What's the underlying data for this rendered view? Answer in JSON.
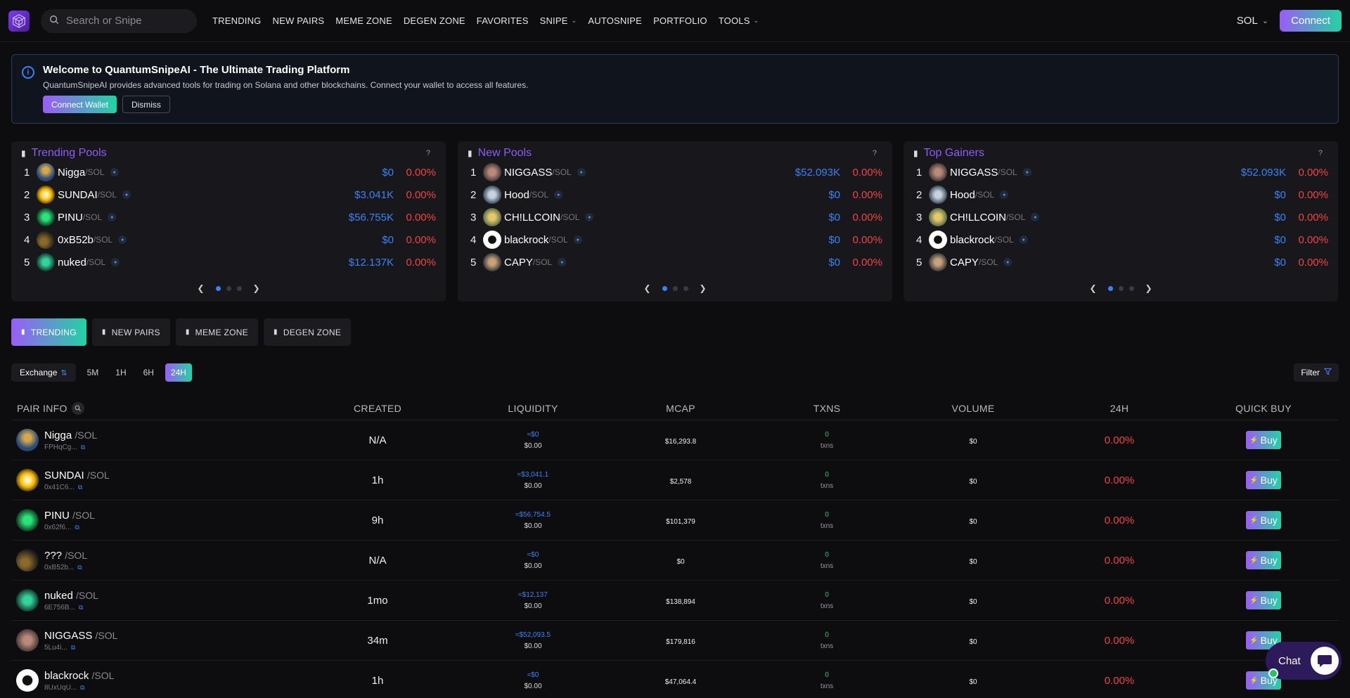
{
  "nav": {
    "search_placeholder": "Search or Snipe",
    "menu": [
      {
        "label": "TRENDING",
        "dropdown": false
      },
      {
        "label": "NEW PAIRS",
        "dropdown": false
      },
      {
        "label": "MEME ZONE",
        "dropdown": false
      },
      {
        "label": "DEGEN ZONE",
        "dropdown": false
      },
      {
        "label": "FAVORITES",
        "dropdown": false
      },
      {
        "label": "SNIPE",
        "dropdown": true
      },
      {
        "label": "AUTOSNIPE",
        "dropdown": false
      },
      {
        "label": "PORTFOLIO",
        "dropdown": false
      },
      {
        "label": "TOOLS",
        "dropdown": true
      }
    ],
    "chain": "SOL",
    "connect_label": "Connect"
  },
  "banner": {
    "title": "Welcome to QuantumSnipeAI - The Ultimate Trading Platform",
    "text": "QuantumSnipeAI provides advanced tools for trading on Solana and other blockchains. Connect your wallet to access all features.",
    "connect_wallet_label": "Connect Wallet",
    "dismiss_label": "Dismiss"
  },
  "cards": [
    {
      "title": "Trending Pools",
      "help": "?",
      "rows": [
        {
          "rank": "1",
          "name": "Nigga",
          "quote": "/SOL",
          "value": "$0",
          "pct": "0.00%"
        },
        {
          "rank": "2",
          "name": "SUNDAI",
          "quote": "/SOL",
          "value": "$3.041K",
          "pct": "0.00%"
        },
        {
          "rank": "3",
          "name": "PINU",
          "quote": "/SOL",
          "value": "$56.755K",
          "pct": "0.00%"
        },
        {
          "rank": "4",
          "name": "0xB52b",
          "quote": "/SOL",
          "value": "$0",
          "pct": "0.00%"
        },
        {
          "rank": "5",
          "name": "nuked",
          "quote": "/SOL",
          "value": "$12.137K",
          "pct": "0.00%"
        }
      ]
    },
    {
      "title": "New Pools",
      "help": "?",
      "rows": [
        {
          "rank": "1",
          "name": "NIGGASS",
          "quote": "/SOL",
          "value": "$52.093K",
          "pct": "0.00%"
        },
        {
          "rank": "2",
          "name": "Hood",
          "quote": "/SOL",
          "value": "$0",
          "pct": "0.00%"
        },
        {
          "rank": "3",
          "name": "CH!LLCOIN",
          "quote": "/SOL",
          "value": "$0",
          "pct": "0.00%"
        },
        {
          "rank": "4",
          "name": "blackrock",
          "quote": "/SOL",
          "value": "$0",
          "pct": "0.00%"
        },
        {
          "rank": "5",
          "name": "CAPY",
          "quote": "/SOL",
          "value": "$0",
          "pct": "0.00%"
        }
      ]
    },
    {
      "title": "Top Gainers",
      "help": "?",
      "rows": [
        {
          "rank": "1",
          "name": "NIGGASS",
          "quote": "/SOL",
          "value": "$52.093K",
          "pct": "0.00%"
        },
        {
          "rank": "2",
          "name": "Hood",
          "quote": "/SOL",
          "value": "$0",
          "pct": "0.00%"
        },
        {
          "rank": "3",
          "name": "CH!LLCOIN",
          "quote": "/SOL",
          "value": "$0",
          "pct": "0.00%"
        },
        {
          "rank": "4",
          "name": "blackrock",
          "quote": "/SOL",
          "value": "$0",
          "pct": "0.00%"
        },
        {
          "rank": "5",
          "name": "CAPY",
          "quote": "/SOL",
          "value": "$0",
          "pct": "0.00%"
        }
      ]
    }
  ],
  "tabs": [
    "TRENDING",
    "NEW PAIRS",
    "MEME ZONE",
    "DEGEN ZONE"
  ],
  "filters": {
    "exchange_label": "Exchange",
    "timeframes": [
      "5M",
      "1H",
      "6H",
      "24H"
    ],
    "active_timeframe": "24H",
    "filter_label": "Filter"
  },
  "table": {
    "headers": {
      "pair": "PAIR INFO",
      "created": "CREATED",
      "liquidity": "LIQUIDITY",
      "mcap": "MCAP",
      "txns": "TXNS",
      "volume": "VOLUME",
      "change": "24H",
      "quick_buy": "QUICK BUY"
    },
    "buy_label": "Buy",
    "rows": [
      {
        "name": "Nigga",
        "quote": "/SOL",
        "addr": "FPHqCg...",
        "created": "N/A",
        "liq_a": "≈$0",
        "liq_b": "$0.00",
        "mcap": "$16,293.8",
        "txns": "0",
        "txns_label": "txns",
        "volume": "$0",
        "change": "0.00%"
      },
      {
        "name": "SUNDAI",
        "quote": "/SOL",
        "addr": "0x41C6...",
        "created": "1h",
        "liq_a": "≈$3,041.1",
        "liq_b": "$0.00",
        "mcap": "$2,578",
        "txns": "0",
        "txns_label": "txns",
        "volume": "$0",
        "change": "0.00%"
      },
      {
        "name": "PINU",
        "quote": "/SOL",
        "addr": "0x62f6...",
        "created": "9h",
        "liq_a": "≈$56,754.5",
        "liq_b": "$0.00",
        "mcap": "$101,379",
        "txns": "0",
        "txns_label": "txns",
        "volume": "$0",
        "change": "0.00%"
      },
      {
        "name": "???",
        "quote": "/SOL",
        "addr": "0xB52b...",
        "created": "N/A",
        "liq_a": "≈$0",
        "liq_b": "$0.00",
        "mcap": "$0",
        "txns": "0",
        "txns_label": "txns",
        "volume": "$0",
        "change": "0.00%"
      },
      {
        "name": "nuked",
        "quote": "/SOL",
        "addr": "6E756B...",
        "created": "1mo",
        "liq_a": "≈$12,137",
        "liq_b": "$0.00",
        "mcap": "$138,894",
        "txns": "0",
        "txns_label": "txns",
        "volume": "$0",
        "change": "0.00%"
      },
      {
        "name": "NIGGASS",
        "quote": "/SOL",
        "addr": "5Lu4i...",
        "created": "34m",
        "liq_a": "≈$52,093.5",
        "liq_b": "$0.00",
        "mcap": "$179,816",
        "txns": "0",
        "txns_label": "txns",
        "volume": "$0",
        "change": "0.00%"
      },
      {
        "name": "blackrock",
        "quote": "/SOL",
        "addr": "8UxUqU...",
        "created": "1h",
        "liq_a": "≈$0",
        "liq_b": "$0.00",
        "mcap": "$47,064.4",
        "txns": "0",
        "txns_label": "txns",
        "volume": "$0",
        "change": "0.00%"
      }
    ]
  },
  "chat": {
    "label": "Chat"
  },
  "colors": {
    "accent_purple": "#8b5cf6",
    "accent_green": "#22d3a3",
    "blue": "#3b82f6",
    "red": "#ef4444",
    "green": "#22c55e"
  }
}
